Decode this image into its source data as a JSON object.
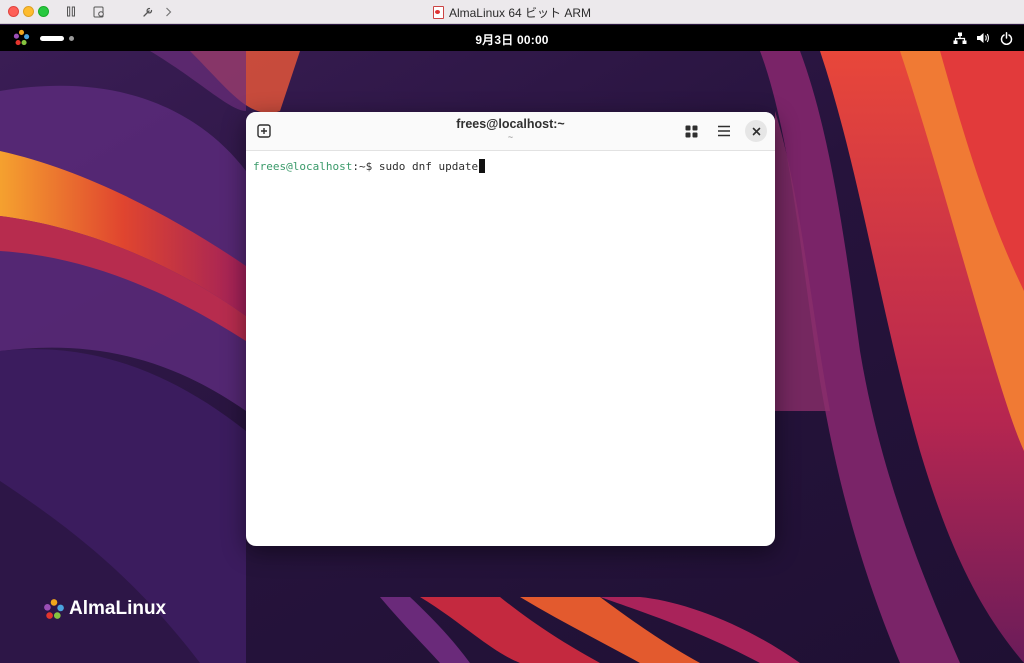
{
  "host_window": {
    "title": "AlmaLinux 64 ビット ARM"
  },
  "top_bar": {
    "clock": "9月3日  00:00"
  },
  "terminal": {
    "title": "frees@localhost:~",
    "subtitle": "~",
    "prompt_user": "frees@localhost",
    "prompt_path": ":~$ ",
    "command": "sudo dnf update"
  },
  "desktop": {
    "brand_text": "AlmaLinux"
  },
  "colors": {
    "prompt_user": "#3a9a6a",
    "wallpaper_base": "#2a1640",
    "accent_orange": "#f0882a",
    "accent_red": "#d8303c"
  }
}
